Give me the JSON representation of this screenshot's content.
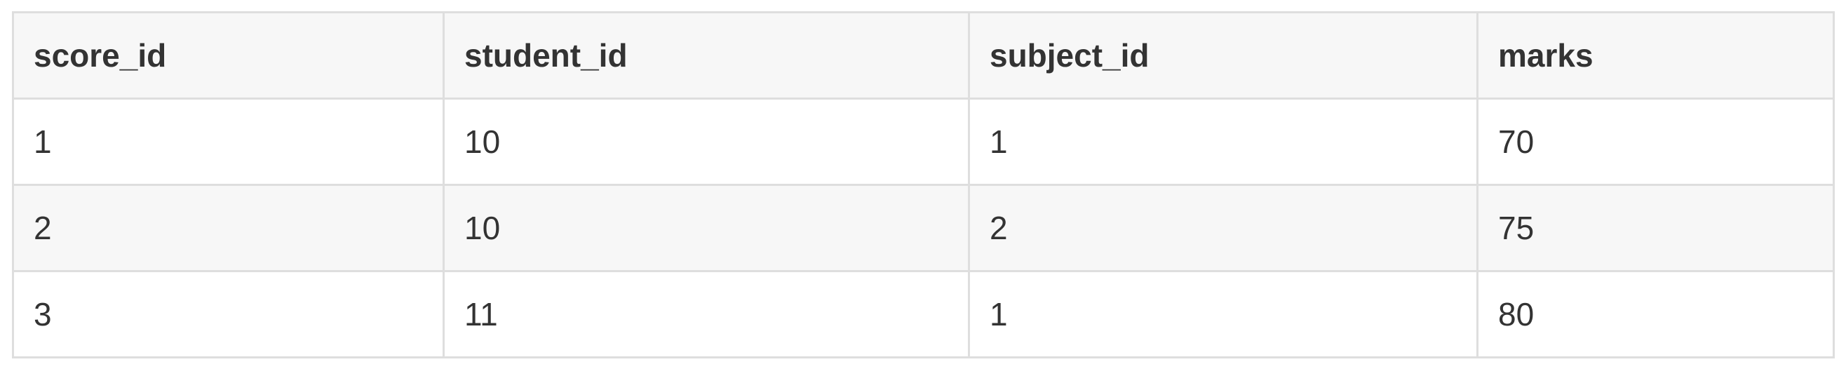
{
  "table": {
    "headers": [
      "score_id",
      "student_id",
      "subject_id",
      "marks"
    ],
    "rows": [
      [
        "1",
        "10",
        "1",
        "70"
      ],
      [
        "2",
        "10",
        "2",
        "75"
      ],
      [
        "3",
        "11",
        "1",
        "80"
      ]
    ]
  },
  "colors": {
    "header_background": "#f7f7f7",
    "alt_row_background": "#f7f7f7",
    "border": "#dedede",
    "text": "#333333"
  }
}
